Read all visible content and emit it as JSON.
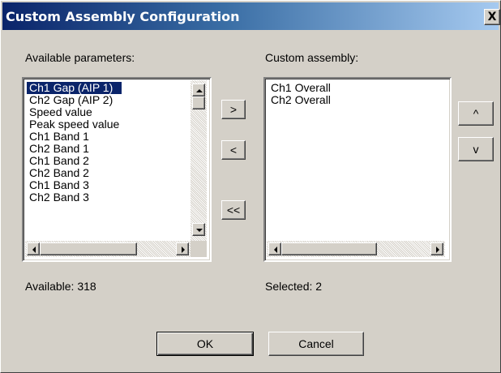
{
  "dialog": {
    "title": "Custom Assembly Configuration",
    "close_label": "X"
  },
  "available": {
    "label": "Available parameters:",
    "items": [
      {
        "label": "Ch1 Gap (AIP 1)",
        "selected": true
      },
      {
        "label": "Ch2 Gap (AIP 2)",
        "selected": false
      },
      {
        "label": "Speed value",
        "selected": false
      },
      {
        "label": "Peak speed value",
        "selected": false
      },
      {
        "label": "Ch1 Band 1",
        "selected": false
      },
      {
        "label": "Ch2 Band 1",
        "selected": false
      },
      {
        "label": "Ch1 Band 2",
        "selected": false
      },
      {
        "label": "Ch2 Band 2",
        "selected": false
      },
      {
        "label": "Ch1 Band 3",
        "selected": false
      },
      {
        "label": "Ch2 Band 3",
        "selected": false
      }
    ],
    "count_text": "Available: 318"
  },
  "custom": {
    "label": "Custom assembly:",
    "items": [
      {
        "label": "Ch1 Overall",
        "selected": false
      },
      {
        "label": "Ch2 Overall",
        "selected": false
      }
    ],
    "count_text": "Selected: 2"
  },
  "transfer_buttons": {
    "add": ">",
    "remove": "<",
    "remove_all": "<<"
  },
  "order_buttons": {
    "up": "^",
    "down": "v"
  },
  "footer": {
    "ok": "OK",
    "cancel": "Cancel"
  },
  "colors": {
    "dialog_bg": "#d4d0c8",
    "title_active": "#0a246a",
    "selection": "#0a246a"
  }
}
